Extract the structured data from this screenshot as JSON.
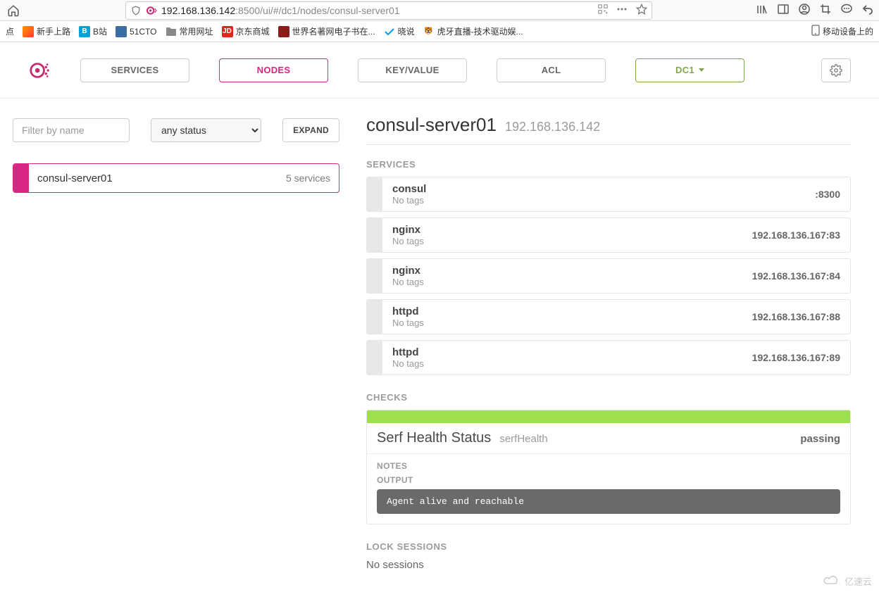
{
  "browser": {
    "url_host": "192.168.136.142",
    "url_rest": ":8500/ui/#/dc1/nodes/consul-server01"
  },
  "bookmarks": {
    "left_label": "点",
    "items": [
      {
        "label": "新手上路"
      },
      {
        "label": "B站"
      },
      {
        "label": "51CTO"
      },
      {
        "label": "常用网址"
      },
      {
        "label": "京东商城"
      },
      {
        "label": "世界名著网电子书在..."
      },
      {
        "label": "晓说"
      },
      {
        "label": "虎牙直播-技术驱动娱..."
      }
    ],
    "right_label": "移动设备上的"
  },
  "nav": {
    "services": "SERVICES",
    "nodes": "NODES",
    "kv": "KEY/VALUE",
    "acl": "ACL",
    "dc": "DC1"
  },
  "filter": {
    "placeholder": "Filter by name",
    "status_value": "any status",
    "expand": "EXPAND"
  },
  "node_list": [
    {
      "name": "consul-server01",
      "meta": "5 services"
    }
  ],
  "node_detail": {
    "title": "consul-server01",
    "ip": "192.168.136.142"
  },
  "sections": {
    "services": "SERVICES",
    "checks": "CHECKS",
    "lock_sessions": "LOCK SESSIONS"
  },
  "services": [
    {
      "name": "consul",
      "tags": "No tags",
      "addr": ":8300"
    },
    {
      "name": "nginx",
      "tags": "No tags",
      "addr": "192.168.136.167:83"
    },
    {
      "name": "nginx",
      "tags": "No tags",
      "addr": "192.168.136.167:84"
    },
    {
      "name": "httpd",
      "tags": "No tags",
      "addr": "192.168.136.167:88"
    },
    {
      "name": "httpd",
      "tags": "No tags",
      "addr": "192.168.136.167:89"
    }
  ],
  "check": {
    "title": "Serf Health Status",
    "id": "serfHealth",
    "state": "passing",
    "notes_label": "NOTES",
    "output_label": "OUTPUT",
    "output": "Agent alive and reachable"
  },
  "sessions": {
    "text": "No sessions"
  },
  "watermark": "亿速云"
}
